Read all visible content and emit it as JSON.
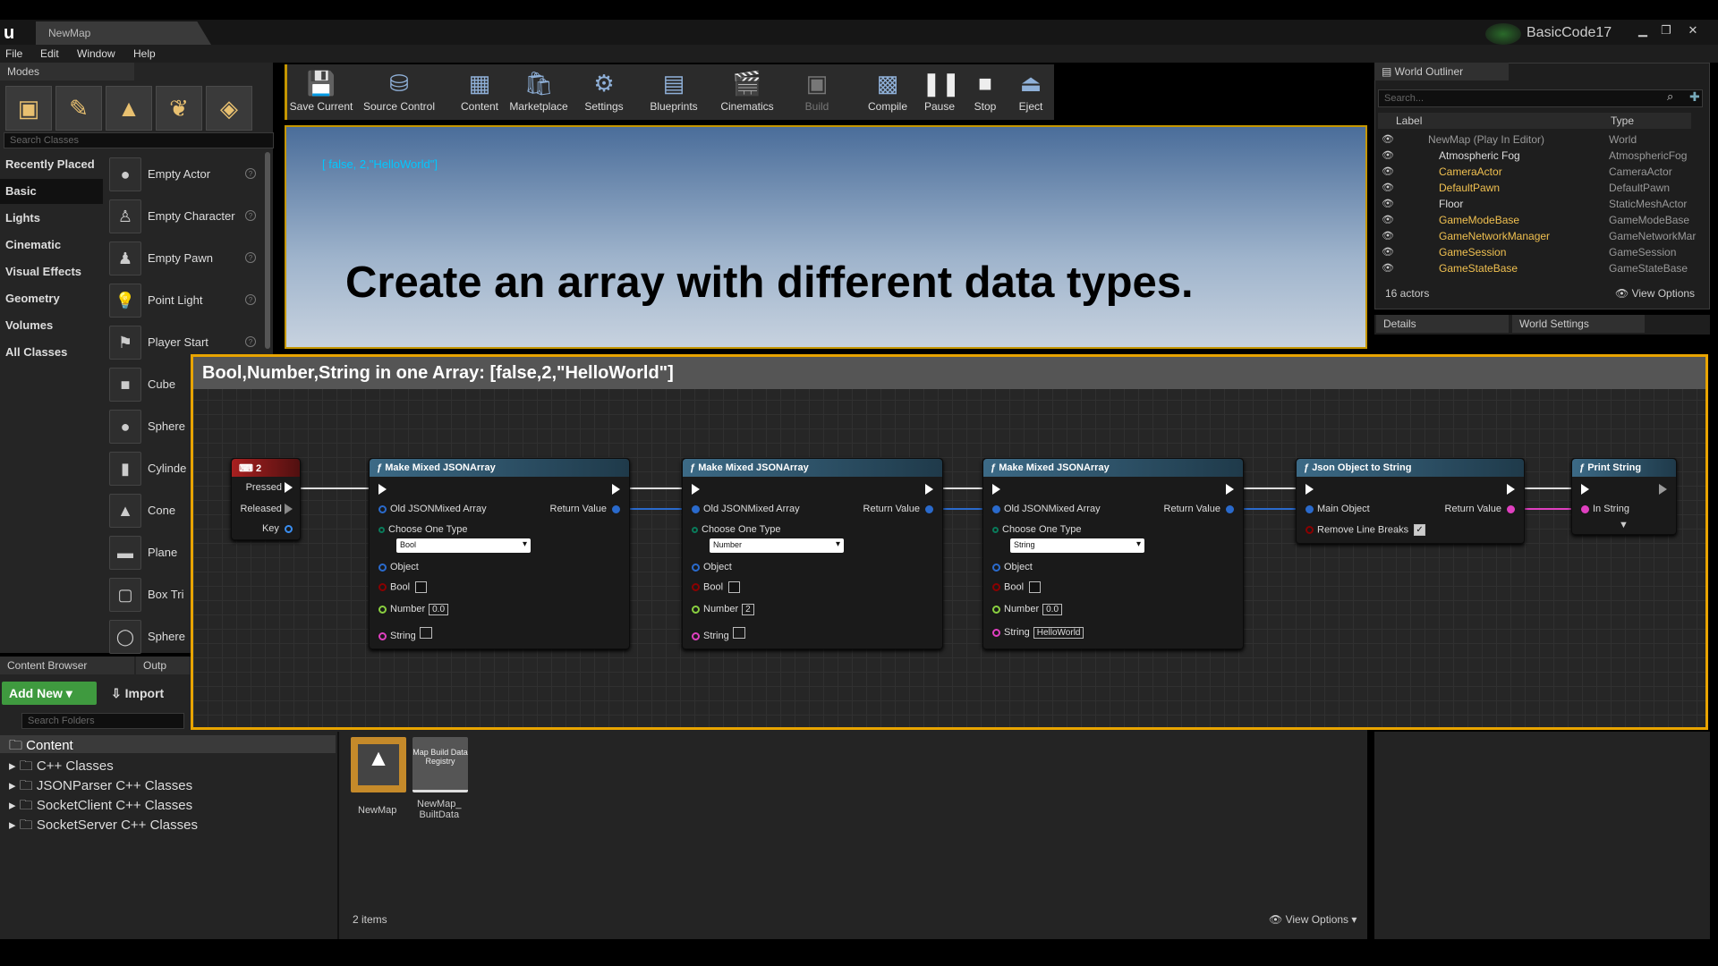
{
  "window": {
    "tab_title": "NewMap",
    "project_name": "BasicCode17",
    "logo": "ue-logo-icon",
    "controls": [
      "minimize-icon",
      "maximize-icon",
      "close-icon"
    ]
  },
  "menu": [
    "File",
    "Edit",
    "Window",
    "Help"
  ],
  "modes": {
    "tab": "Modes",
    "tools": [
      "place-icon",
      "paint-icon",
      "landscape-icon",
      "foliage-icon",
      "geometry-edit-icon"
    ],
    "search_placeholder": "Search Classes",
    "categories": [
      "Recently Placed",
      "Basic",
      "Lights",
      "Cinematic",
      "Visual Effects",
      "Geometry",
      "Volumes",
      "All Classes"
    ],
    "selected_category": "Basic",
    "items": [
      "Empty Actor",
      "Empty Character",
      "Empty Pawn",
      "Point Light",
      "Player Start",
      "Cube",
      "Sphere",
      "Cylinde",
      "Cone",
      "Plane",
      "Box Tri",
      "Sphere"
    ]
  },
  "toolbar": {
    "buttons": [
      {
        "label": "Save Current",
        "icon": "save-icon"
      },
      {
        "label": "Source Control",
        "icon": "source-control-icon"
      },
      {
        "label": "Content",
        "icon": "content-icon"
      },
      {
        "label": "Marketplace",
        "icon": "marketplace-icon"
      },
      {
        "label": "Settings",
        "icon": "settings-icon"
      },
      {
        "label": "Blueprints",
        "icon": "blueprints-icon"
      },
      {
        "label": "Cinematics",
        "icon": "cinematics-icon"
      },
      {
        "label": "Build",
        "icon": "build-icon"
      },
      {
        "label": "Compile",
        "icon": "compile-icon"
      },
      {
        "label": "Pause",
        "icon": "pause-icon"
      },
      {
        "label": "Stop",
        "icon": "stop-icon"
      },
      {
        "label": "Eject",
        "icon": "eject-icon"
      }
    ]
  },
  "viewport": {
    "debug_text": "[ false, 2,\"HelloWorld\"]",
    "title": "Create an array with different data types."
  },
  "graph": {
    "comment": "Bool,Number,String in one Array: [false,2,\"HelloWorld\"]",
    "key_node": {
      "title": "2",
      "pins": [
        "Pressed",
        "Released",
        "Key"
      ]
    },
    "make_nodes": [
      {
        "title": "Make Mixed JSONArray",
        "old": "Old JSONMixed Array",
        "ret": "Return Value",
        "choose": "Choose One Type",
        "type": "Bool",
        "object": "Object",
        "bool": "Bool",
        "number": "Number",
        "number_val": "0.0",
        "string": "String",
        "string_val": ""
      },
      {
        "title": "Make Mixed JSONArray",
        "old": "Old JSONMixed Array",
        "ret": "Return Value",
        "choose": "Choose One Type",
        "type": "Number",
        "object": "Object",
        "bool": "Bool",
        "number": "Number",
        "number_val": "2",
        "string": "String",
        "string_val": ""
      },
      {
        "title": "Make Mixed JSONArray",
        "old": "Old JSONMixed Array",
        "ret": "Return Value",
        "choose": "Choose One Type",
        "type": "String",
        "object": "Object",
        "bool": "Bool",
        "number": "Number",
        "number_val": "0.0",
        "string": "String",
        "string_val": "HelloWorld"
      }
    ],
    "json_node": {
      "title": "Json Object to String",
      "main": "Main Object",
      "ret": "Return Value",
      "remove": "Remove Line Breaks"
    },
    "print_node": {
      "title": "Print String",
      "in": "In String"
    }
  },
  "outliner": {
    "tab": "World Outliner",
    "search_placeholder": "Search...",
    "col_label": "Label",
    "col_type": "Type",
    "rows": [
      {
        "label": "NewMap (Play In Editor)",
        "type": "World"
      },
      {
        "label": "Atmospheric Fog",
        "type": "AtmosphericFog"
      },
      {
        "label": "CameraActor",
        "type": "CameraActor"
      },
      {
        "label": "DefaultPawn",
        "type": "DefaultPawn"
      },
      {
        "label": "Floor",
        "type": "StaticMeshActor"
      },
      {
        "label": "GameModeBase",
        "type": "GameModeBase"
      },
      {
        "label": "GameNetworkManager",
        "type": "GameNetworkMar"
      },
      {
        "label": "GameSession",
        "type": "GameSession"
      },
      {
        "label": "GameStateBase",
        "type": "GameStateBase"
      }
    ],
    "count": "16 actors",
    "view_options": "View Options"
  },
  "details": {
    "tab1": "Details",
    "tab2": "World Settings"
  },
  "content_browser": {
    "tab1": "Content Browser",
    "tab2": "Outp",
    "add_new": "Add New",
    "import": "Import",
    "search_placeholder": "Search Folders",
    "root": "Content",
    "folders": [
      "C++ Classes",
      "JSONParser C++ Classes",
      "SocketClient C++ Classes",
      "SocketServer C++ Classes"
    ],
    "assets": [
      {
        "name": "NewMap",
        "thumb": ""
      },
      {
        "name": "NewMap_\nBuiltData",
        "thumb": "Map Build Data Registry"
      }
    ],
    "count": "2 items",
    "view_options": "View Options"
  }
}
